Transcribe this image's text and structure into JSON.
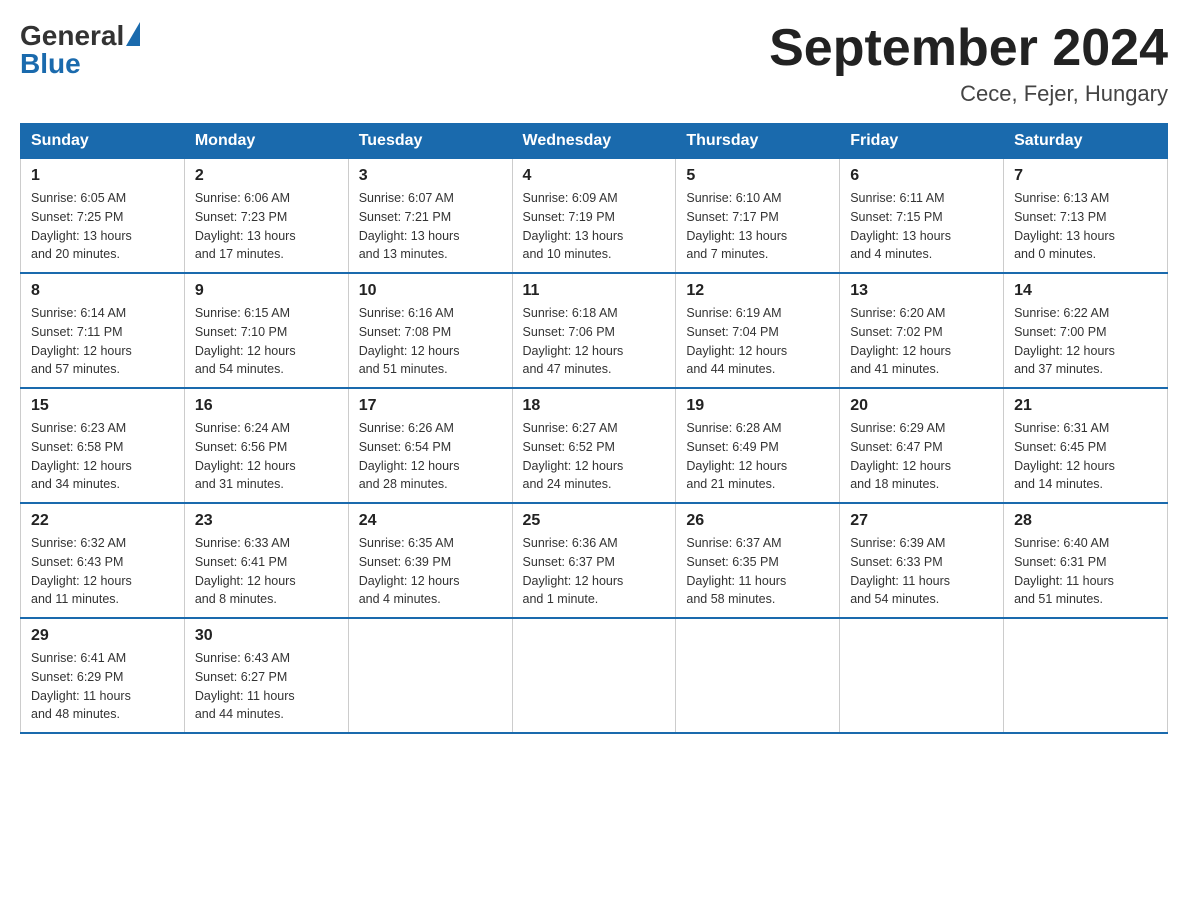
{
  "logo": {
    "general": "General",
    "blue": "Blue"
  },
  "title": "September 2024",
  "location": "Cece, Fejer, Hungary",
  "days_of_week": [
    "Sunday",
    "Monday",
    "Tuesday",
    "Wednesday",
    "Thursday",
    "Friday",
    "Saturday"
  ],
  "weeks": [
    [
      {
        "num": "1",
        "sunrise": "6:05 AM",
        "sunset": "7:25 PM",
        "daylight": "13 hours and 20 minutes."
      },
      {
        "num": "2",
        "sunrise": "6:06 AM",
        "sunset": "7:23 PM",
        "daylight": "13 hours and 17 minutes."
      },
      {
        "num": "3",
        "sunrise": "6:07 AM",
        "sunset": "7:21 PM",
        "daylight": "13 hours and 13 minutes."
      },
      {
        "num": "4",
        "sunrise": "6:09 AM",
        "sunset": "7:19 PM",
        "daylight": "13 hours and 10 minutes."
      },
      {
        "num": "5",
        "sunrise": "6:10 AM",
        "sunset": "7:17 PM",
        "daylight": "13 hours and 7 minutes."
      },
      {
        "num": "6",
        "sunrise": "6:11 AM",
        "sunset": "7:15 PM",
        "daylight": "13 hours and 4 minutes."
      },
      {
        "num": "7",
        "sunrise": "6:13 AM",
        "sunset": "7:13 PM",
        "daylight": "13 hours and 0 minutes."
      }
    ],
    [
      {
        "num": "8",
        "sunrise": "6:14 AM",
        "sunset": "7:11 PM",
        "daylight": "12 hours and 57 minutes."
      },
      {
        "num": "9",
        "sunrise": "6:15 AM",
        "sunset": "7:10 PM",
        "daylight": "12 hours and 54 minutes."
      },
      {
        "num": "10",
        "sunrise": "6:16 AM",
        "sunset": "7:08 PM",
        "daylight": "12 hours and 51 minutes."
      },
      {
        "num": "11",
        "sunrise": "6:18 AM",
        "sunset": "7:06 PM",
        "daylight": "12 hours and 47 minutes."
      },
      {
        "num": "12",
        "sunrise": "6:19 AM",
        "sunset": "7:04 PM",
        "daylight": "12 hours and 44 minutes."
      },
      {
        "num": "13",
        "sunrise": "6:20 AM",
        "sunset": "7:02 PM",
        "daylight": "12 hours and 41 minutes."
      },
      {
        "num": "14",
        "sunrise": "6:22 AM",
        "sunset": "7:00 PM",
        "daylight": "12 hours and 37 minutes."
      }
    ],
    [
      {
        "num": "15",
        "sunrise": "6:23 AM",
        "sunset": "6:58 PM",
        "daylight": "12 hours and 34 minutes."
      },
      {
        "num": "16",
        "sunrise": "6:24 AM",
        "sunset": "6:56 PM",
        "daylight": "12 hours and 31 minutes."
      },
      {
        "num": "17",
        "sunrise": "6:26 AM",
        "sunset": "6:54 PM",
        "daylight": "12 hours and 28 minutes."
      },
      {
        "num": "18",
        "sunrise": "6:27 AM",
        "sunset": "6:52 PM",
        "daylight": "12 hours and 24 minutes."
      },
      {
        "num": "19",
        "sunrise": "6:28 AM",
        "sunset": "6:49 PM",
        "daylight": "12 hours and 21 minutes."
      },
      {
        "num": "20",
        "sunrise": "6:29 AM",
        "sunset": "6:47 PM",
        "daylight": "12 hours and 18 minutes."
      },
      {
        "num": "21",
        "sunrise": "6:31 AM",
        "sunset": "6:45 PM",
        "daylight": "12 hours and 14 minutes."
      }
    ],
    [
      {
        "num": "22",
        "sunrise": "6:32 AM",
        "sunset": "6:43 PM",
        "daylight": "12 hours and 11 minutes."
      },
      {
        "num": "23",
        "sunrise": "6:33 AM",
        "sunset": "6:41 PM",
        "daylight": "12 hours and 8 minutes."
      },
      {
        "num": "24",
        "sunrise": "6:35 AM",
        "sunset": "6:39 PM",
        "daylight": "12 hours and 4 minutes."
      },
      {
        "num": "25",
        "sunrise": "6:36 AM",
        "sunset": "6:37 PM",
        "daylight": "12 hours and 1 minute."
      },
      {
        "num": "26",
        "sunrise": "6:37 AM",
        "sunset": "6:35 PM",
        "daylight": "11 hours and 58 minutes."
      },
      {
        "num": "27",
        "sunrise": "6:39 AM",
        "sunset": "6:33 PM",
        "daylight": "11 hours and 54 minutes."
      },
      {
        "num": "28",
        "sunrise": "6:40 AM",
        "sunset": "6:31 PM",
        "daylight": "11 hours and 51 minutes."
      }
    ],
    [
      {
        "num": "29",
        "sunrise": "6:41 AM",
        "sunset": "6:29 PM",
        "daylight": "11 hours and 48 minutes."
      },
      {
        "num": "30",
        "sunrise": "6:43 AM",
        "sunset": "6:27 PM",
        "daylight": "11 hours and 44 minutes."
      },
      null,
      null,
      null,
      null,
      null
    ]
  ],
  "labels": {
    "sunrise": "Sunrise:",
    "sunset": "Sunset:",
    "daylight": "Daylight:"
  }
}
